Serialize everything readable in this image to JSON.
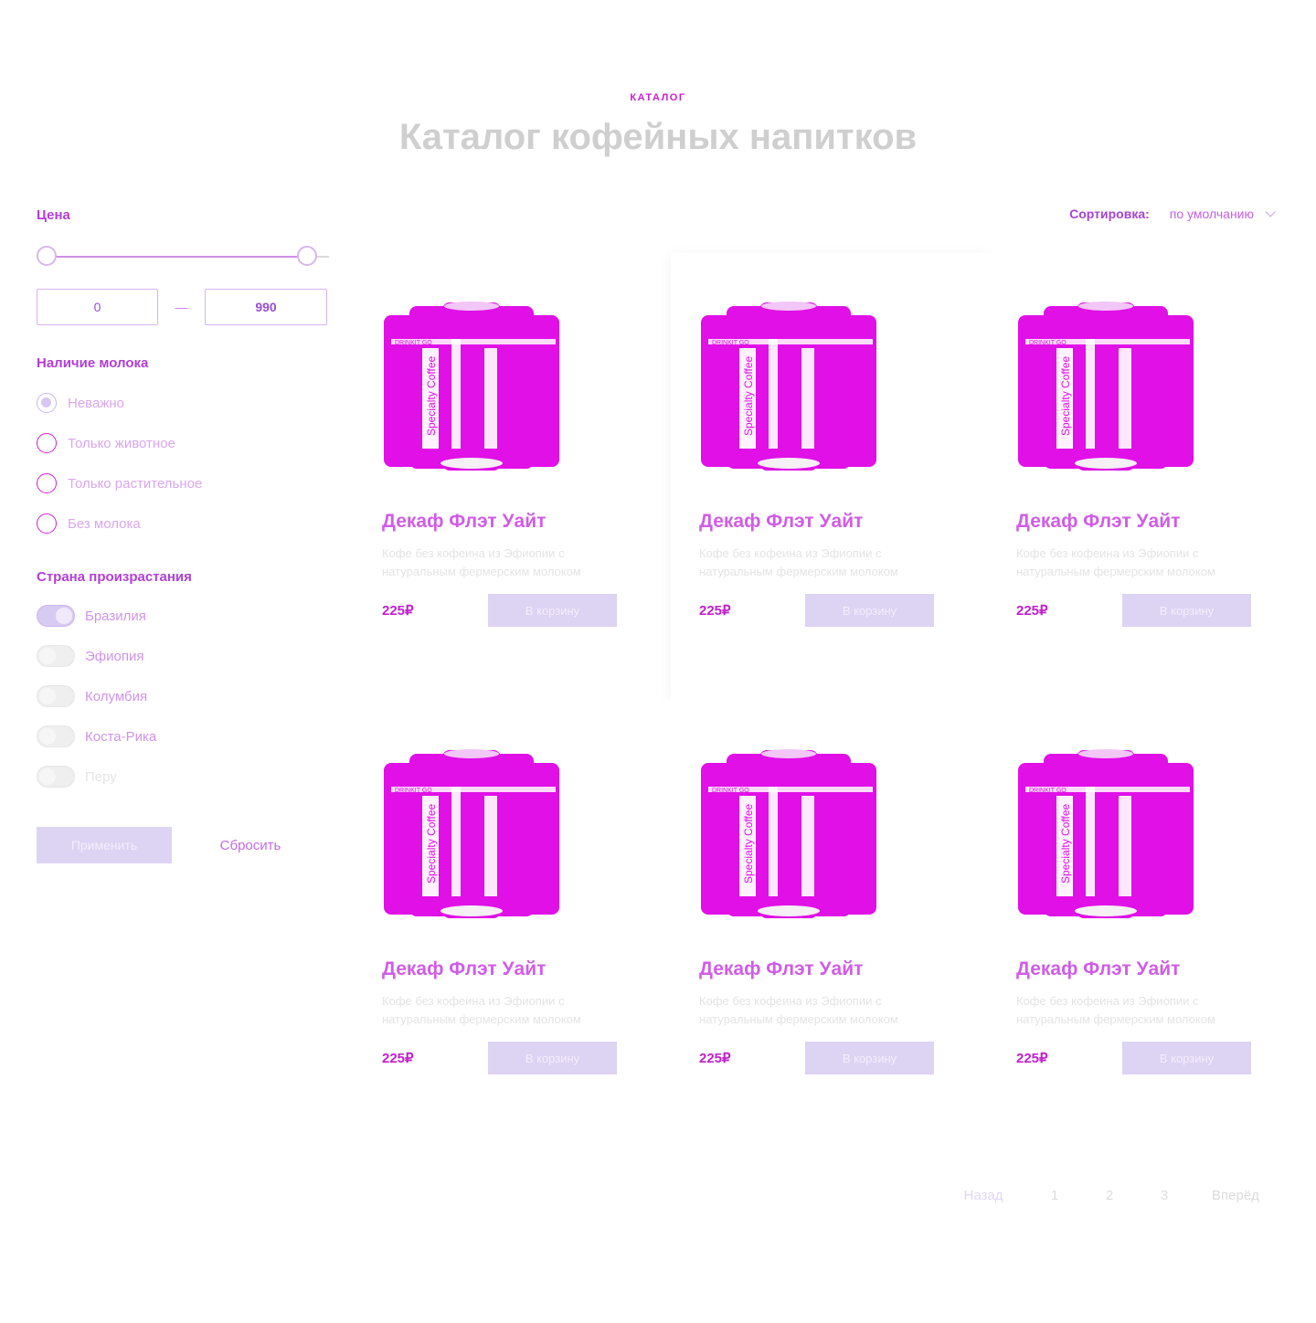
{
  "header": {
    "eyebrow": "КАТАЛОГ",
    "title": "Каталог кофейных напитков"
  },
  "filters": {
    "price": {
      "label": "Цена",
      "min_value": "0",
      "max_value": "990",
      "range_start": 0,
      "range_end": 1,
      "separator": "—"
    },
    "milk": {
      "label": "Наличие молока",
      "options": [
        {
          "label": "Неважно",
          "checked": true
        },
        {
          "label": "Только животное",
          "checked": false
        },
        {
          "label": "Только растительное",
          "checked": false
        },
        {
          "label": "Без молока",
          "checked": false
        }
      ]
    },
    "country": {
      "label": "Страна произрастания",
      "options": [
        {
          "label": "Бразилия",
          "on": true
        },
        {
          "label": "Эфиопия",
          "on": false
        },
        {
          "label": "Колумбия",
          "on": false
        },
        {
          "label": "Коста-Рика",
          "on": false
        },
        {
          "label": "Перу",
          "on": false
        }
      ]
    },
    "apply_label": "Применить",
    "reset_label": "Сбросить"
  },
  "sort": {
    "label": "Сортировка:",
    "value": "по умолчанию"
  },
  "products": [
    {
      "title": "Декаф Флэт Уайт",
      "desc": "Кофе без кофеина из Эфиопии с натуральным фермерским молоком",
      "price": "225₽",
      "button": "В корзину",
      "can_text": "Specialty Coffee",
      "can_brand": "DRINKIT GO"
    },
    {
      "title": "Декаф Флэт Уайт",
      "desc": "Кофе без кофеина из Эфиопии с натуральным фермерским молоком",
      "price": "225₽",
      "button": "В корзину",
      "can_text": "Specialty Coffee",
      "can_brand": "DRINKIT GO"
    },
    {
      "title": "Декаф Флэт Уайт",
      "desc": "Кофе без кофеина из Эфиопии с натуральным фермерским молоком",
      "price": "225₽",
      "button": "В корзину",
      "can_text": "Specialty Coffee",
      "can_brand": "DRINKIT GO"
    },
    {
      "title": "Декаф Флэт Уайт",
      "desc": "Кофе без кофеина из Эфиопии с натуральным фермерским молоком",
      "price": "225₽",
      "button": "В корзину",
      "can_text": "Specialty Coffee",
      "can_brand": "DRINKIT GO"
    },
    {
      "title": "Декаф Флэт Уайт",
      "desc": "Кофе без кофеина из Эфиопии с натуральным фермерским молоком",
      "price": "225₽",
      "button": "В корзину",
      "can_text": "Specialty Coffee",
      "can_brand": "DRINKIT GO"
    },
    {
      "title": "Декаф Флэт Уайт",
      "desc": "Кофе без кофеина из Эфиопии с натуральным фермерским молоком",
      "price": "225₽",
      "button": "В корзину",
      "can_text": "Specialty Coffee",
      "can_brand": "DRINKIT GO"
    }
  ],
  "pagination": {
    "prev": "Назад",
    "pages": [
      "1",
      "2",
      "3"
    ],
    "next": "Вперёд"
  },
  "colors": {
    "accent": "#c21fce",
    "can": "#e010e6",
    "button_bg": "#ddd3f3"
  }
}
